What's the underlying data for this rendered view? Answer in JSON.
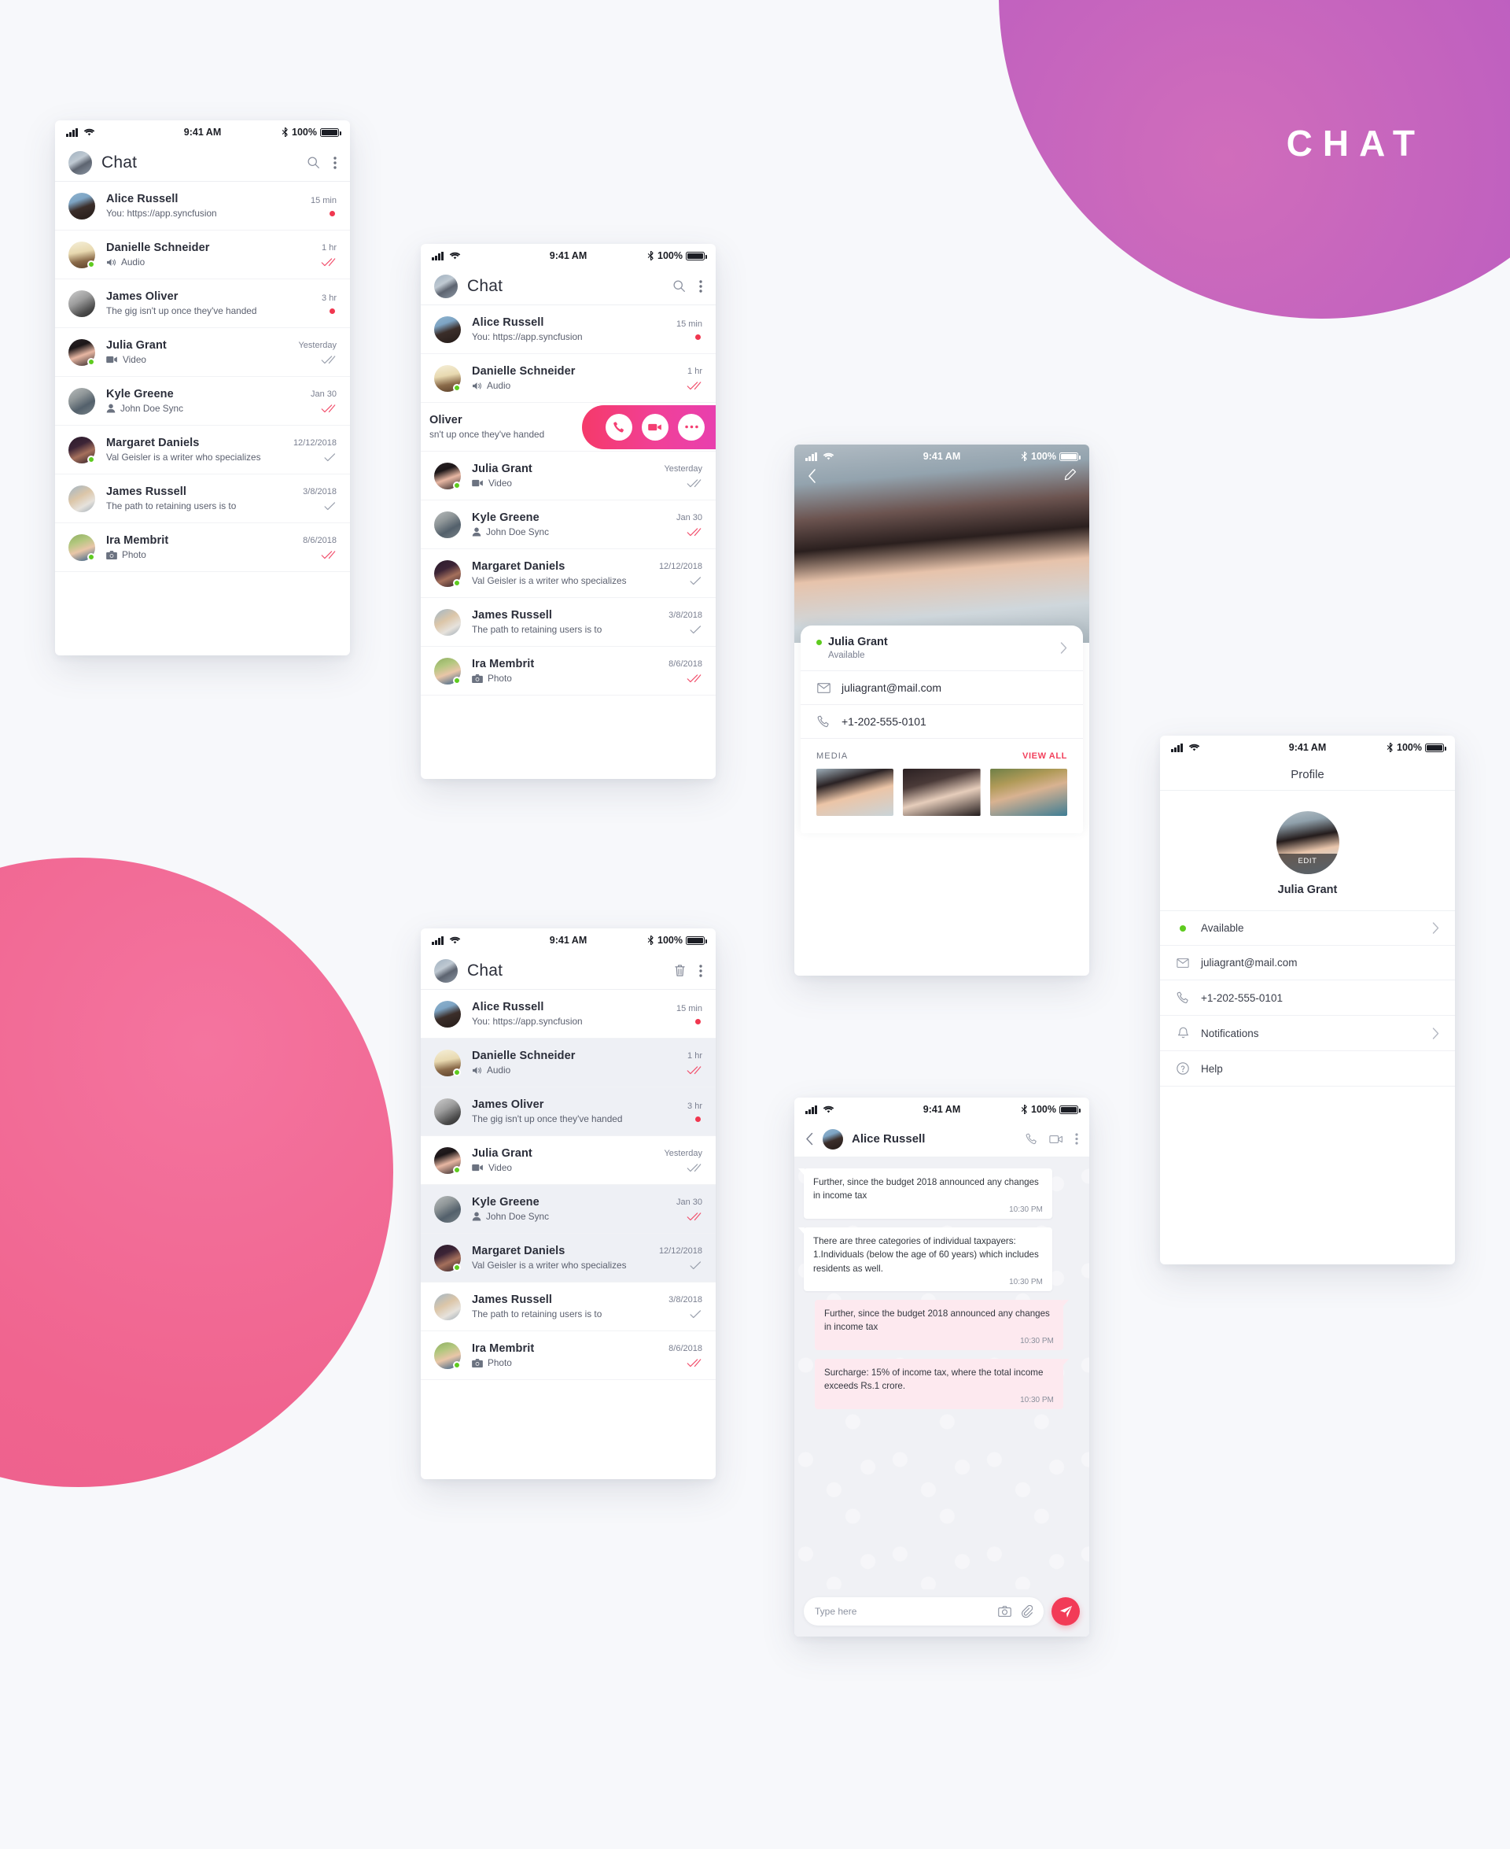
{
  "wordmark": "CHAT",
  "colors": {
    "accent_pink": "#F0648F",
    "accent_purple": "#BD5EC0",
    "accent_red": "#F23B57",
    "status_green": "#5ECB1F",
    "page_bg": "#F7F8FB"
  },
  "status_bar": {
    "time": "9:41 AM",
    "battery": "100%"
  },
  "chat_list": {
    "title": "Chat",
    "icons": {
      "search": "search-icon",
      "more": "more-vertical-icon",
      "delete": "trash-icon"
    },
    "rows": [
      {
        "name": "Alice Russell",
        "preview": "You: https://app.syncfusion",
        "time": "15 min",
        "state": "unread",
        "icon": "",
        "online": false
      },
      {
        "name": "Danielle Schneider",
        "preview": "Audio",
        "time": "1 hr",
        "state": "read",
        "icon": "audio-icon",
        "online": true
      },
      {
        "name": "James Oliver",
        "preview": "The gig isn't up once they've handed",
        "time": "3 hr",
        "state": "unread",
        "icon": "",
        "online": false
      },
      {
        "name": "Julia Grant",
        "preview": "Video",
        "time": "Yesterday",
        "state": "delivered",
        "icon": "video-icon",
        "online": true
      },
      {
        "name": "Kyle Greene",
        "preview": "John Doe Sync",
        "time": "Jan 30",
        "state": "read",
        "icon": "contact-icon",
        "online": false
      },
      {
        "name": "Margaret Daniels",
        "preview": "Val Geisler is a writer who specializes",
        "time": "12/12/2018",
        "state": "sent",
        "icon": "",
        "online": true
      },
      {
        "name": "James Russell",
        "preview": "The path to retaining users is to",
        "time": "3/8/2018",
        "state": "sent",
        "icon": "",
        "online": false
      },
      {
        "name": "Ira Membrit",
        "preview": "Photo",
        "time": "8/6/2018",
        "state": "read",
        "icon": "photo-icon",
        "online": true
      }
    ]
  },
  "swipe_actions": {
    "partial_name": "Oliver",
    "partial_preview": "sn't up once they've handed",
    "buttons": [
      "call-icon",
      "video-camera-icon",
      "more-horizontal-icon"
    ]
  },
  "selection_screen": {
    "title": "Chat",
    "selected_names": [
      "Danielle Schneider",
      "James Oliver",
      "Kyle Greene",
      "Margaret Daniels"
    ]
  },
  "profile_card": {
    "name": "Julia Grant",
    "presence": "Available",
    "email": "juliagrant@mail.com",
    "phone": "+1-202-555-0101",
    "media_label": "MEDIA",
    "view_all": "VIEW ALL",
    "back_icon": "chevron-left-icon",
    "edit_icon": "pencil-icon",
    "thumbs": 3
  },
  "profile_screen": {
    "header_title": "Profile",
    "avatar_edit_label": "EDIT",
    "name": "Julia Grant",
    "rows": [
      {
        "label": "Available",
        "icon": "status-dot-icon",
        "chevron": true
      },
      {
        "label": "juliagrant@mail.com",
        "icon": "envelope-icon",
        "chevron": false
      },
      {
        "label": "+1-202-555-0101",
        "icon": "phone-icon",
        "chevron": false
      },
      {
        "label": "Notifications",
        "icon": "bell-icon",
        "chevron": true
      },
      {
        "label": "Help",
        "icon": "question-icon",
        "chevron": false
      }
    ]
  },
  "conversation": {
    "contact": "Alice Russell",
    "actions": [
      "phone-icon",
      "video-camera-icon",
      "more-vertical-icon"
    ],
    "messages": [
      {
        "dir": "in",
        "text": "Further, since the budget 2018  announced any changes in income tax",
        "time": "10:30 PM"
      },
      {
        "dir": "in",
        "text": "There are three categories of individual taxpayers: 1.Individuals (below the age of 60 years) which includes residents as well.",
        "time": "10:30 PM"
      },
      {
        "dir": "out",
        "text": "Further, since the budget 2018  announced any changes in income tax",
        "time": "10:30 PM"
      },
      {
        "dir": "out",
        "text": "Surcharge: 15% of income tax, where the total income exceeds Rs.1 crore.",
        "time": "10:30 PM"
      }
    ],
    "composer": {
      "placeholder": "Type here",
      "camera": "camera-icon",
      "attach": "paperclip-icon",
      "send": "send-icon"
    }
  }
}
